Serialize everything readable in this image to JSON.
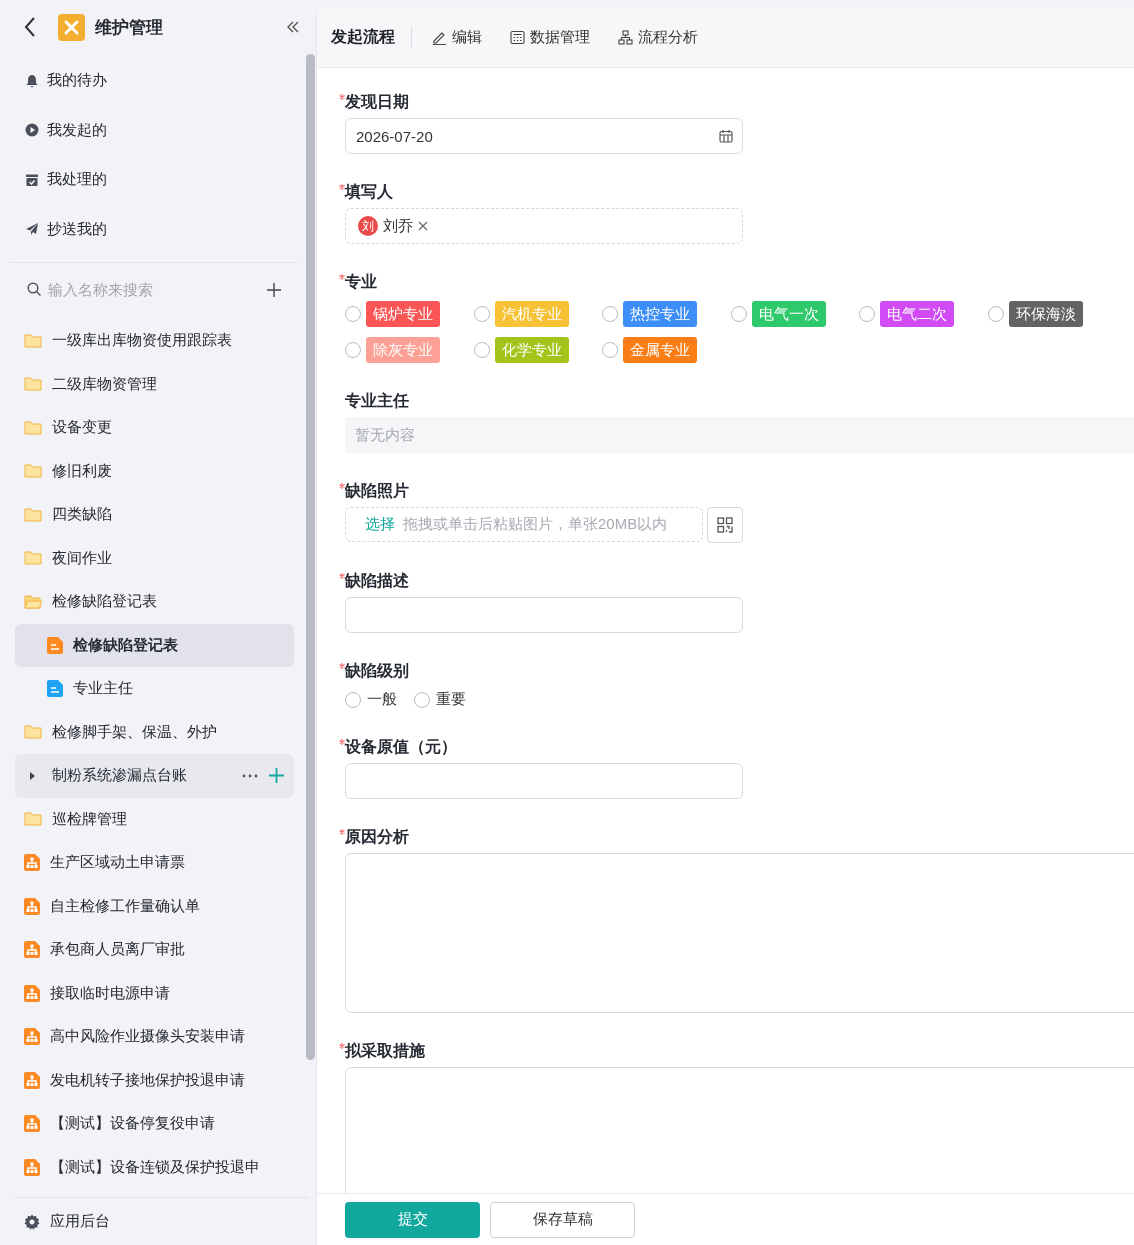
{
  "app": {
    "title": "维护管理"
  },
  "nav": [
    {
      "label": "我的待办"
    },
    {
      "label": "我发起的"
    },
    {
      "label": "我处理的"
    },
    {
      "label": "抄送我的"
    }
  ],
  "search": {
    "placeholder": "输入名称来搜索"
  },
  "tree": [
    {
      "kind": "folder",
      "label": "一级库出库物资使用跟踪表",
      "expanded": false,
      "selected": false,
      "hovered": false
    },
    {
      "kind": "folder",
      "label": "二级库物资管理",
      "expanded": false,
      "selected": false,
      "hovered": false
    },
    {
      "kind": "folder",
      "label": "设备变更",
      "expanded": false,
      "selected": false,
      "hovered": false
    },
    {
      "kind": "folder",
      "label": "修旧利废",
      "expanded": false,
      "selected": false,
      "hovered": false
    },
    {
      "kind": "folder",
      "label": "四类缺陷",
      "expanded": false,
      "selected": false,
      "hovered": false
    },
    {
      "kind": "folder",
      "label": "夜间作业",
      "expanded": false,
      "selected": false,
      "hovered": false
    },
    {
      "kind": "folder",
      "label": "检修缺陷登记表",
      "expanded": true,
      "selected": false,
      "hovered": false,
      "children": [
        {
          "kind": "form",
          "label": "检修缺陷登记表",
          "color": "#ff8a1f",
          "selected": true,
          "hovered": false
        },
        {
          "kind": "form",
          "label": "专业主任",
          "color": "#1fa4f5",
          "selected": false,
          "hovered": false
        }
      ]
    },
    {
      "kind": "folder",
      "label": "检修脚手架、保温、外护",
      "expanded": false,
      "selected": false,
      "hovered": false
    },
    {
      "kind": "group",
      "label": "制粉系统渗漏点台账",
      "expanded": false,
      "selected": false,
      "hovered": true
    },
    {
      "kind": "folder",
      "label": "巡检牌管理",
      "expanded": false,
      "selected": false,
      "hovered": false
    },
    {
      "kind": "flow",
      "label": "生产区域动土申请票",
      "selected": false,
      "hovered": false
    },
    {
      "kind": "flow",
      "label": "自主检修工作量确认单",
      "selected": false,
      "hovered": false
    },
    {
      "kind": "flow",
      "label": "承包商人员离厂审批",
      "selected": false,
      "hovered": false
    },
    {
      "kind": "flow",
      "label": "接取临时电源申请",
      "selected": false,
      "hovered": false
    },
    {
      "kind": "flow",
      "label": "高中风险作业摄像头安装申请",
      "selected": false,
      "hovered": false
    },
    {
      "kind": "flow",
      "label": "发电机转子接地保护投退申请",
      "selected": false,
      "hovered": false
    },
    {
      "kind": "flow",
      "label": "【测试】设备停复役申请",
      "selected": false,
      "hovered": false
    },
    {
      "kind": "flow",
      "label": "【测试】设备连锁及保护投退申",
      "selected": false,
      "hovered": false
    }
  ],
  "footer_link": {
    "label": "应用后台"
  },
  "tabs": [
    {
      "label": "发起流程",
      "selected": true
    },
    {
      "label": "编辑",
      "selected": false
    },
    {
      "label": "数据管理",
      "selected": false
    },
    {
      "label": "流程分析",
      "selected": false
    }
  ],
  "fields": [
    {
      "kind": "date",
      "label": "发现日期",
      "required": true,
      "value": "2026-07-20"
    },
    {
      "kind": "user",
      "label": "填写人",
      "required": true,
      "users": [
        {
          "avatar": "刘",
          "name": "刘乔"
        }
      ]
    },
    {
      "kind": "tags",
      "label": "专业",
      "required": true,
      "options": [
        {
          "label": "锅炉专业",
          "color": "#fb5555",
          "selected": false
        },
        {
          "label": "汽机专业",
          "color": "#f7c236",
          "selected": false
        },
        {
          "label": "热控专业",
          "color": "#3d8ef8",
          "selected": false
        },
        {
          "label": "电气一次",
          "color": "#2ec96b",
          "selected": false
        },
        {
          "label": "电气二次",
          "color": "#d14cf4",
          "selected": false
        },
        {
          "label": "环保海淡",
          "color": "#636363",
          "selected": false
        },
        {
          "label": "除灰专业",
          "color": "#fda096",
          "selected": false
        },
        {
          "label": "化学专业",
          "color": "#a3c51b",
          "selected": false
        },
        {
          "label": "金属专业",
          "color": "#fb7d16",
          "selected": false
        }
      ]
    },
    {
      "kind": "readonly",
      "label": "专业主任",
      "required": false,
      "placeholder": "暂无内容"
    },
    {
      "kind": "upload",
      "label": "缺陷照片",
      "required": true,
      "action": "选择",
      "hint": "拖拽或单击后粘贴图片，单张20MB以内"
    },
    {
      "kind": "text",
      "label": "缺陷描述",
      "required": true
    },
    {
      "kind": "radio",
      "label": "缺陷级别",
      "required": true,
      "options": [
        {
          "label": "一般",
          "selected": false
        },
        {
          "label": "重要",
          "selected": false
        }
      ]
    },
    {
      "kind": "text",
      "label": "设备原值（元）",
      "required": true
    },
    {
      "kind": "textarea",
      "label": "原因分析",
      "required": true
    },
    {
      "kind": "textarea",
      "label": "拟采取措施",
      "required": true
    }
  ],
  "actions": [
    {
      "label": "提交",
      "kind": "primary"
    },
    {
      "label": "保存草稿",
      "kind": "secondary"
    }
  ]
}
